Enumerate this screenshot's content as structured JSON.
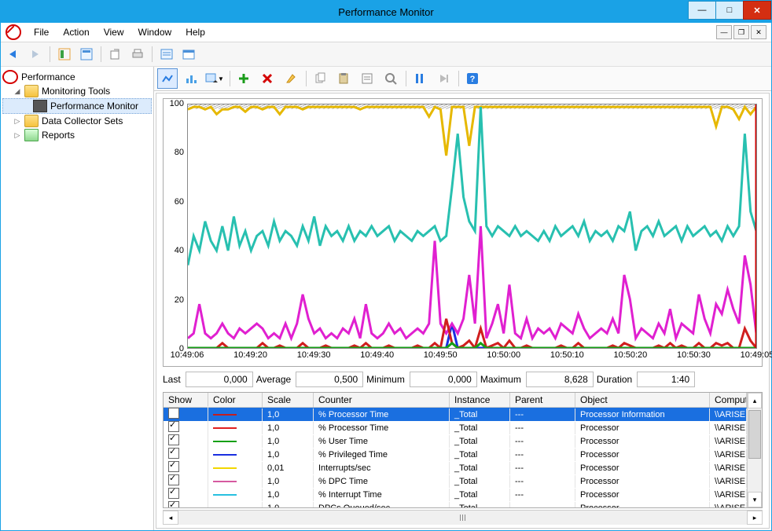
{
  "title": "Performance Monitor",
  "menu": [
    "File",
    "Action",
    "View",
    "Window",
    "Help"
  ],
  "tree": {
    "root": "Performance",
    "nodes": [
      {
        "label": "Monitoring Tools",
        "children": [
          {
            "label": "Performance Monitor",
            "selected": true
          }
        ]
      },
      {
        "label": "Data Collector Sets"
      },
      {
        "label": "Reports"
      }
    ]
  },
  "stats": {
    "last_label": "Last",
    "last": "0,000",
    "avg_label": "Average",
    "avg": "0,500",
    "min_label": "Minimum",
    "min": "0,000",
    "max_label": "Maximum",
    "max": "8,628",
    "dur_label": "Duration",
    "dur": "1:40"
  },
  "grid": {
    "headers": {
      "show": "Show",
      "color": "Color",
      "scale": "Scale",
      "counter": "Counter",
      "instance": "Instance",
      "parent": "Parent",
      "object": "Object",
      "computer": "Computer"
    },
    "rows": [
      {
        "show": true,
        "color": "#c41e1e",
        "scale": "1,0",
        "counter": "% Processor Time",
        "instance": "_Total",
        "parent": "---",
        "object": "Processor Information",
        "computer": "\\\\ARISERVER",
        "sel": true
      },
      {
        "show": true,
        "color": "#e02020",
        "scale": "1,0",
        "counter": "% Processor Time",
        "instance": "_Total",
        "parent": "---",
        "object": "Processor",
        "computer": "\\\\ARISERVER"
      },
      {
        "show": true,
        "color": "#16a016",
        "scale": "1,0",
        "counter": "% User Time",
        "instance": "_Total",
        "parent": "---",
        "object": "Processor",
        "computer": "\\\\ARISERVER"
      },
      {
        "show": true,
        "color": "#1a2fe0",
        "scale": "1,0",
        "counter": "% Privileged Time",
        "instance": "_Total",
        "parent": "---",
        "object": "Processor",
        "computer": "\\\\ARISERVER"
      },
      {
        "show": true,
        "color": "#f2d600",
        "scale": "0,01",
        "counter": "Interrupts/sec",
        "instance": "_Total",
        "parent": "---",
        "object": "Processor",
        "computer": "\\\\ARISERVER"
      },
      {
        "show": true,
        "color": "#d65aa0",
        "scale": "1,0",
        "counter": "% DPC Time",
        "instance": "_Total",
        "parent": "---",
        "object": "Processor",
        "computer": "\\\\ARISERVER"
      },
      {
        "show": true,
        "color": "#28c0e0",
        "scale": "1,0",
        "counter": "% Interrupt Time",
        "instance": "_Total",
        "parent": "---",
        "object": "Processor",
        "computer": "\\\\ARISERVER"
      },
      {
        "show": true,
        "color": "#e020d0",
        "scale": "1,0",
        "counter": "DPCs Queued/sec",
        "instance": "_Total",
        "parent": "---",
        "object": "Processor",
        "computer": "\\\\ARISERVER"
      }
    ]
  },
  "chart_data": {
    "type": "line",
    "ylim": [
      0,
      100
    ],
    "y_ticks": [
      0,
      20,
      40,
      60,
      80,
      100
    ],
    "x_ticks": [
      "10:49:06",
      "10:49:20",
      "10:49:30",
      "10:49:40",
      "10:49:50",
      "10:50:00",
      "10:50:10",
      "10:50:20",
      "10:50:30",
      "10:49:05"
    ],
    "x": [
      0,
      1,
      2,
      3,
      4,
      5,
      6,
      7,
      8,
      9,
      10,
      11,
      12,
      13,
      14,
      15,
      16,
      17,
      18,
      19,
      20,
      21,
      22,
      23,
      24,
      25,
      26,
      27,
      28,
      29,
      30,
      31,
      32,
      33,
      34,
      35,
      36,
      37,
      38,
      39,
      40,
      41,
      42,
      43,
      44,
      45,
      46,
      47,
      48,
      49,
      50,
      51,
      52,
      53,
      54,
      55,
      56,
      57,
      58,
      59,
      60,
      61,
      62,
      63,
      64,
      65,
      66,
      67,
      68,
      69,
      70,
      71,
      72,
      73,
      74,
      75,
      76,
      77,
      78,
      79,
      80,
      81,
      82,
      83,
      84,
      85,
      86,
      87,
      88,
      89,
      90,
      91,
      92,
      93,
      94,
      95,
      96,
      97,
      98,
      99
    ],
    "series": [
      {
        "name": "Interrupts/sec",
        "color": "#e6b800",
        "values": [
          98,
          99,
          99,
          98,
          99,
          96,
          98,
          98,
          99,
          99,
          97,
          99,
          99,
          98,
          99,
          99,
          96,
          99,
          99,
          99,
          98,
          99,
          99,
          99,
          99,
          99,
          99,
          99,
          99,
          99,
          98,
          99,
          99,
          99,
          99,
          99,
          99,
          99,
          99,
          99,
          99,
          99,
          95,
          99,
          98,
          79,
          99,
          99,
          99,
          83,
          99,
          99,
          99,
          99,
          99,
          99,
          99,
          99,
          99,
          99,
          99,
          99,
          99,
          99,
          99,
          99,
          99,
          99,
          99,
          99,
          99,
          99,
          99,
          99,
          99,
          99,
          99,
          99,
          99,
          99,
          99,
          99,
          99,
          99,
          99,
          99,
          99,
          99,
          99,
          99,
          99,
          99,
          91,
          99,
          99,
          98,
          94,
          99,
          96,
          99
        ]
      },
      {
        "name": "% Privileged Time",
        "color": "#1a2fe0",
        "values": [
          0,
          0,
          0,
          0,
          0,
          0,
          0,
          0,
          0,
          0,
          0,
          0,
          0,
          0,
          0,
          0,
          0,
          0,
          0,
          0,
          0,
          0,
          0,
          0,
          0,
          0,
          0,
          0,
          0,
          0,
          0,
          0,
          0,
          0,
          0,
          0,
          0,
          0,
          0,
          0,
          0,
          0,
          0,
          0,
          0,
          0,
          10,
          0,
          0,
          0,
          0,
          0,
          0,
          0,
          0,
          0,
          0,
          0,
          0,
          0,
          0,
          0,
          0,
          0,
          0,
          0,
          0,
          0,
          0,
          0,
          0,
          0,
          0,
          0,
          0,
          0,
          0,
          0,
          0,
          0,
          0,
          0,
          0,
          0,
          0,
          0,
          0,
          0,
          0,
          0,
          0,
          0,
          0,
          0,
          0,
          0,
          0,
          0,
          0,
          0
        ]
      },
      {
        "name": "% Interrupt Time",
        "color": "#28c0b0",
        "values": [
          34,
          46,
          40,
          52,
          44,
          40,
          50,
          40,
          54,
          42,
          48,
          40,
          46,
          48,
          42,
          52,
          44,
          48,
          46,
          42,
          50,
          44,
          54,
          42,
          50,
          46,
          48,
          44,
          50,
          44,
          48,
          46,
          50,
          46,
          48,
          50,
          44,
          48,
          46,
          44,
          48,
          46,
          48,
          50,
          44,
          46,
          66,
          88,
          62,
          52,
          48,
          99,
          50,
          46,
          50,
          48,
          46,
          50,
          46,
          48,
          46,
          44,
          48,
          44,
          50,
          46,
          48,
          50,
          46,
          52,
          44,
          48,
          46,
          48,
          44,
          50,
          48,
          56,
          40,
          48,
          50,
          46,
          52,
          46,
          48,
          50,
          44,
          50,
          46,
          48,
          50,
          46,
          48,
          44,
          50,
          46,
          50,
          88,
          56,
          48
        ]
      },
      {
        "name": "DPCs Queued/sec",
        "color": "#e020d0",
        "values": [
          4,
          6,
          18,
          6,
          4,
          6,
          10,
          6,
          4,
          8,
          6,
          8,
          10,
          8,
          4,
          6,
          4,
          10,
          4,
          10,
          22,
          12,
          6,
          8,
          4,
          6,
          4,
          8,
          6,
          12,
          4,
          18,
          6,
          4,
          6,
          10,
          6,
          8,
          4,
          6,
          8,
          6,
          10,
          44,
          10,
          6,
          10,
          6,
          12,
          30,
          10,
          50,
          4,
          10,
          18,
          6,
          26,
          6,
          4,
          12,
          4,
          8,
          6,
          8,
          4,
          10,
          8,
          6,
          14,
          8,
          4,
          6,
          8,
          6,
          12,
          6,
          30,
          20,
          4,
          8,
          6,
          4,
          10,
          6,
          16,
          4,
          10,
          8,
          6,
          22,
          12,
          6,
          18,
          14,
          24,
          16,
          10,
          38,
          26,
          6
        ]
      },
      {
        "name": "% Processor Time",
        "color": "#d01e1e",
        "values": [
          0,
          0,
          0,
          0,
          0,
          0,
          2,
          0,
          0,
          0,
          0,
          0,
          0,
          2,
          0,
          0,
          1,
          0,
          0,
          0,
          2,
          0,
          0,
          0,
          1,
          0,
          0,
          0,
          0,
          1,
          0,
          2,
          0,
          0,
          0,
          1,
          0,
          0,
          0,
          0,
          1,
          0,
          0,
          2,
          0,
          12,
          2,
          0,
          1,
          3,
          0,
          8,
          0,
          1,
          2,
          0,
          3,
          0,
          0,
          1,
          0,
          0,
          0,
          0,
          0,
          1,
          0,
          0,
          2,
          0,
          0,
          0,
          0,
          0,
          1,
          0,
          2,
          1,
          0,
          0,
          0,
          0,
          1,
          0,
          2,
          0,
          1,
          0,
          0,
          2,
          0,
          0,
          2,
          1,
          2,
          0,
          0,
          8,
          3,
          0
        ]
      },
      {
        "name": "% User Time",
        "color": "#16a016",
        "values": [
          0,
          0,
          0,
          0,
          0,
          0,
          0,
          0,
          0,
          0,
          0,
          0,
          0,
          0,
          0,
          0,
          0,
          0,
          0,
          0,
          0,
          0,
          0,
          0,
          0,
          0,
          0,
          0,
          0,
          0,
          0,
          0,
          0,
          0,
          0,
          0,
          0,
          0,
          0,
          0,
          0,
          0,
          0,
          0,
          0,
          0,
          2,
          0,
          0,
          0,
          0,
          2,
          0,
          0,
          0,
          0,
          0,
          0,
          0,
          0,
          0,
          0,
          0,
          0,
          0,
          0,
          0,
          0,
          0,
          0,
          0,
          0,
          0,
          0,
          0,
          0,
          0,
          0,
          0,
          0,
          0,
          0,
          0,
          0,
          0,
          0,
          0,
          0,
          0,
          0,
          0,
          0,
          0,
          0,
          0,
          0,
          0,
          0,
          0,
          0
        ]
      }
    ],
    "cursor_x": 99
  }
}
